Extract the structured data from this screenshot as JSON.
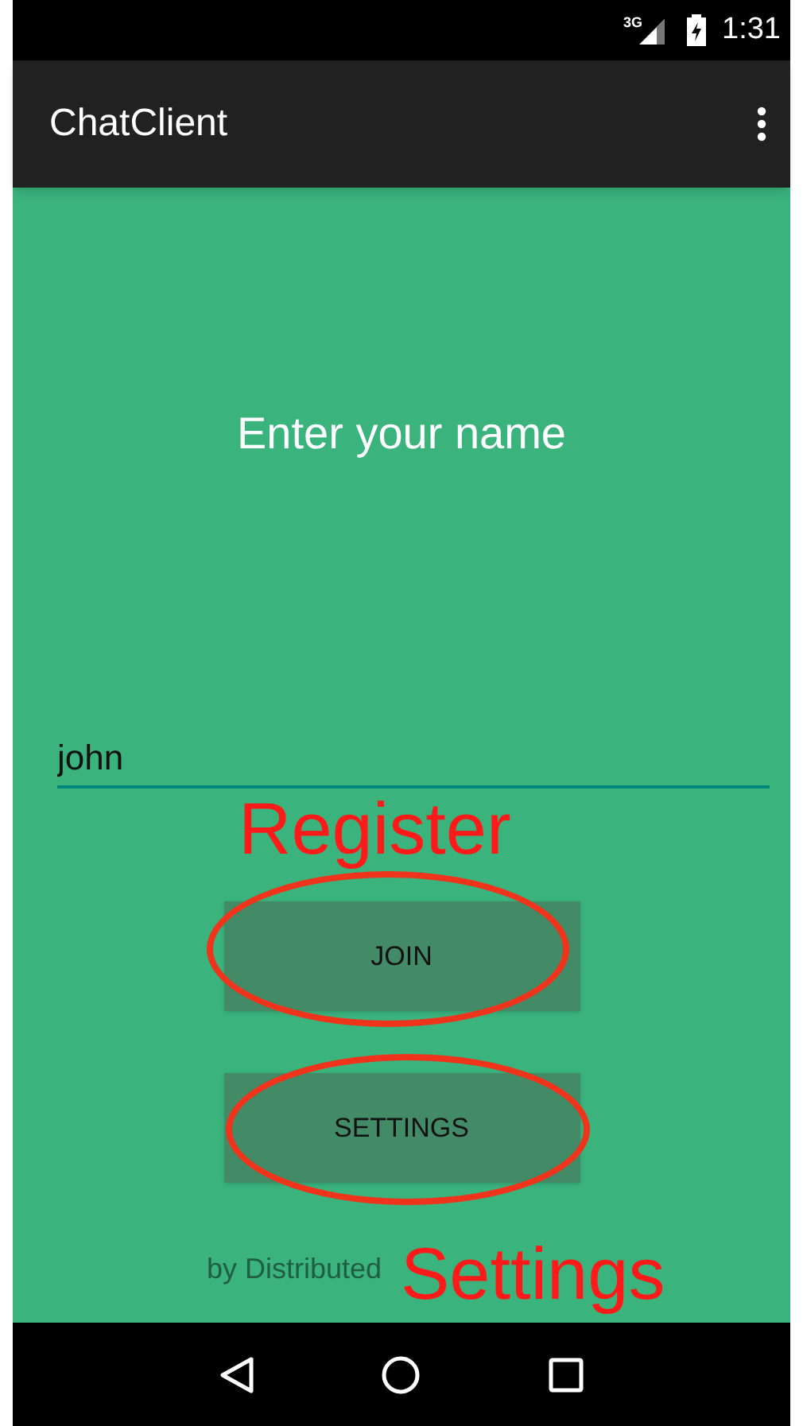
{
  "status_bar": {
    "network": "3G",
    "time": "1:31"
  },
  "app_bar": {
    "title": "ChatClient"
  },
  "prompt": "Enter your name",
  "name_field": {
    "value": "john"
  },
  "buttons": [
    {
      "label": "JOIN"
    },
    {
      "label": "SETTINGS"
    }
  ],
  "footer": "by Distributed",
  "annotations": [
    {
      "kind": "label",
      "text": "Register"
    },
    {
      "kind": "ellipse"
    },
    {
      "kind": "ellipse"
    },
    {
      "kind": "label",
      "text": "Settings"
    }
  ]
}
